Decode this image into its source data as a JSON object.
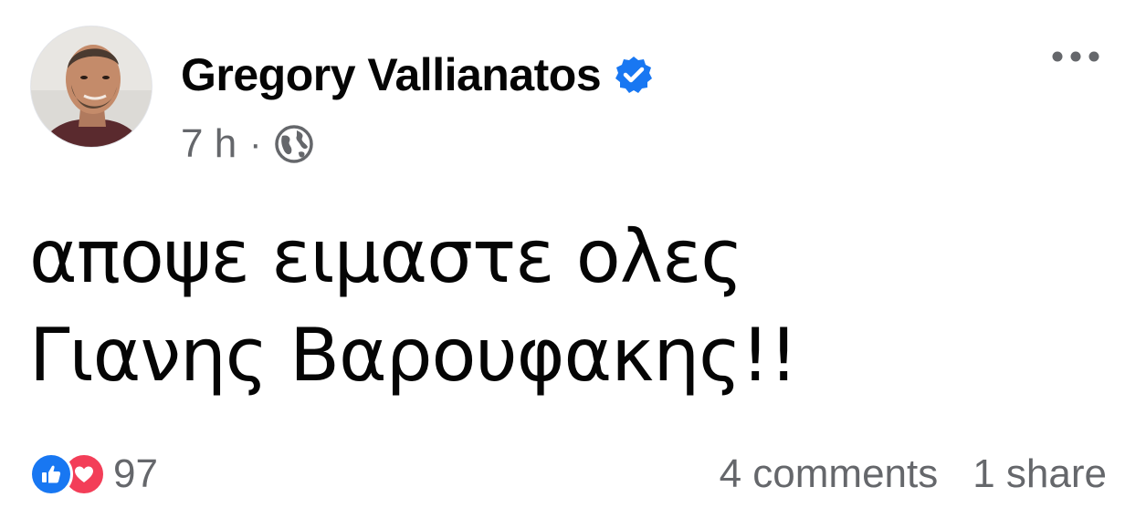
{
  "post": {
    "author": {
      "name": "Gregory Vallianatos",
      "verified": true
    },
    "meta": {
      "timestamp": "7 h",
      "separator": "·",
      "audience_icon": "globe-icon"
    },
    "more_icon": "more-options-icon",
    "text": {
      "line1": "αποψε ειμαστε ολες",
      "line2": "Γιανης Βαρουφακης!!"
    },
    "footer": {
      "reaction_icons": [
        "like-icon",
        "love-icon"
      ],
      "reaction_count": "97",
      "comments": "4 comments",
      "shares": "1 share"
    },
    "colors": {
      "like": "#1877f2",
      "love": "#f33e58",
      "verified": "#1877f2",
      "secondary_text": "#65676b",
      "primary_text": "#050505"
    }
  }
}
